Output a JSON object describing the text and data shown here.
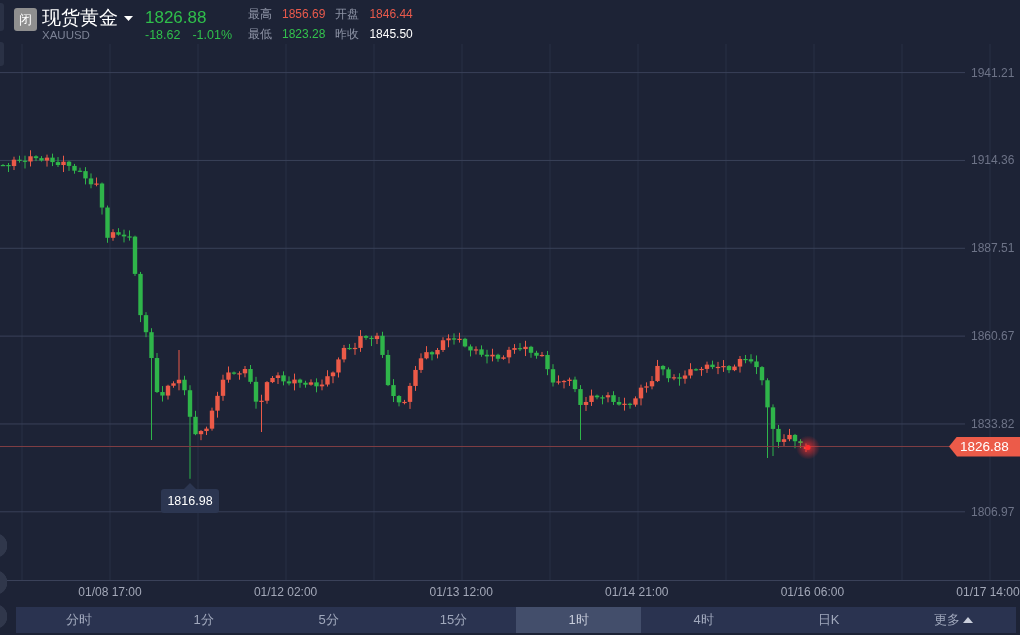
{
  "header": {
    "status_badge": "闭",
    "name": "现货黄金",
    "code": "XAUUSD",
    "rising": false,
    "price": "1826.88",
    "change": "-18.62",
    "change_percent": "-1.01%",
    "stats": [
      {
        "label": "最高",
        "value": "1856.69",
        "color": "#ea5a4c"
      },
      {
        "label": "开盘",
        "value": "1846.44",
        "color": "#ea5a4c"
      },
      {
        "label": "最低",
        "value": "1823.28",
        "color": "#33c24d"
      },
      {
        "label": "昨收",
        "value": "1845.50",
        "color": "#ffffff"
      }
    ]
  },
  "chart": {
    "price_axis_labels": [
      "1941.21",
      "1914.36",
      "1887.51",
      "1860.67",
      "1833.82",
      "1806.97"
    ],
    "time_axis_labels": [
      "01/08 17:00",
      "01/12 02:00",
      "01/13 12:00",
      "01/14 21:00",
      "01/16 06:00",
      "01/17 14:00"
    ],
    "last_price_tag": "1826.88",
    "low_price_marker": "1816.98"
  },
  "timeframes": [
    {
      "label": "分时",
      "kind": "period",
      "selected": false
    },
    {
      "label": "1分",
      "kind": "period",
      "selected": false
    },
    {
      "label": "5分",
      "kind": "period",
      "selected": false
    },
    {
      "label": "15分",
      "kind": "period",
      "selected": false
    },
    {
      "label": "1时",
      "kind": "period",
      "selected": true
    },
    {
      "label": "4时",
      "kind": "period",
      "selected": false
    },
    {
      "label": "日K",
      "kind": "period",
      "selected": false
    },
    {
      "label": "更多",
      "kind": "menu",
      "selected": false
    }
  ]
}
